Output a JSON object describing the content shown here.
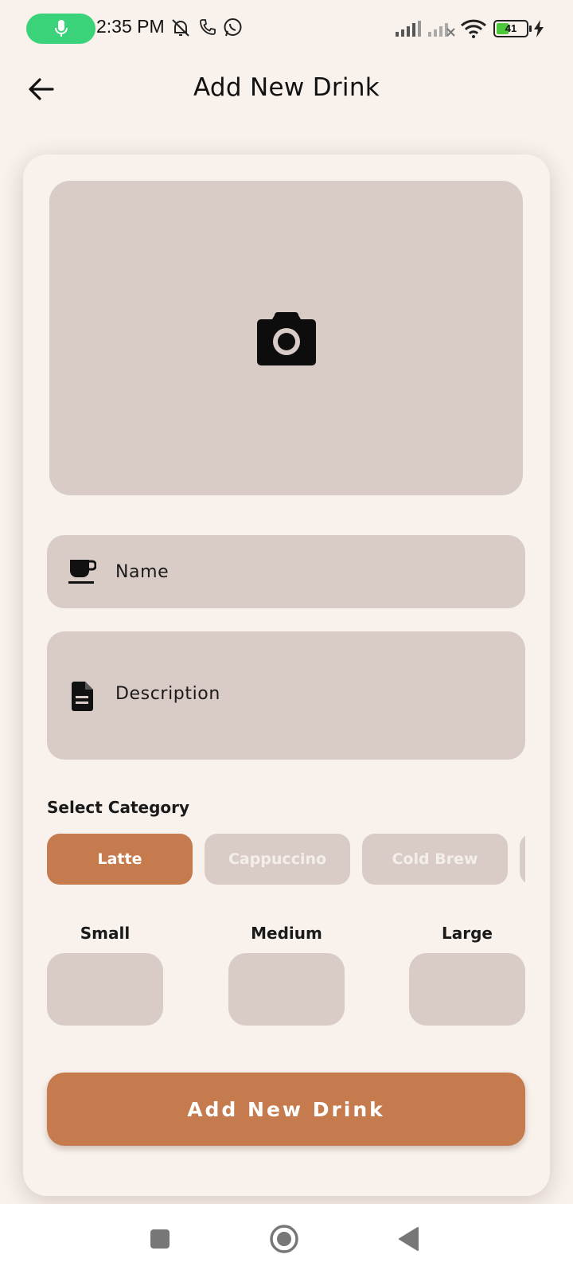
{
  "status_bar": {
    "time": "2:35 PM",
    "battery": "41",
    "icons": [
      "mic-icon",
      "bell-off-icon",
      "phone-icon",
      "whatsapp-icon",
      "signal-icon",
      "signal-no-sim-icon",
      "wifi-icon",
      "battery-icon",
      "charging-icon"
    ]
  },
  "header": {
    "title": "Add New Drink",
    "back_icon": "arrow-left-icon"
  },
  "form": {
    "image_picker_icon": "camera-icon",
    "name": {
      "placeholder": "Name",
      "value": "",
      "icon": "coffee-cup-icon"
    },
    "description": {
      "placeholder": "Description",
      "value": "",
      "icon": "document-icon"
    },
    "category_label": "Select Category",
    "categories": [
      {
        "label": "Latte",
        "selected": true
      },
      {
        "label": "Cappuccino",
        "selected": false
      },
      {
        "label": "Cold Brew",
        "selected": false
      },
      {
        "label": "",
        "selected": false
      }
    ],
    "sizes": [
      {
        "label": "Small",
        "value": ""
      },
      {
        "label": "Medium",
        "value": ""
      },
      {
        "label": "Large",
        "value": ""
      }
    ],
    "submit_label": "Add New Drink"
  },
  "nav_bar": {
    "icons": [
      "recents-square-icon",
      "home-circle-icon",
      "back-triangle-icon"
    ]
  },
  "colors": {
    "background": "#f8f1ec",
    "field": "#d9ccc7",
    "accent": "#c67b4e",
    "mic_pill": "#3bd37a"
  }
}
